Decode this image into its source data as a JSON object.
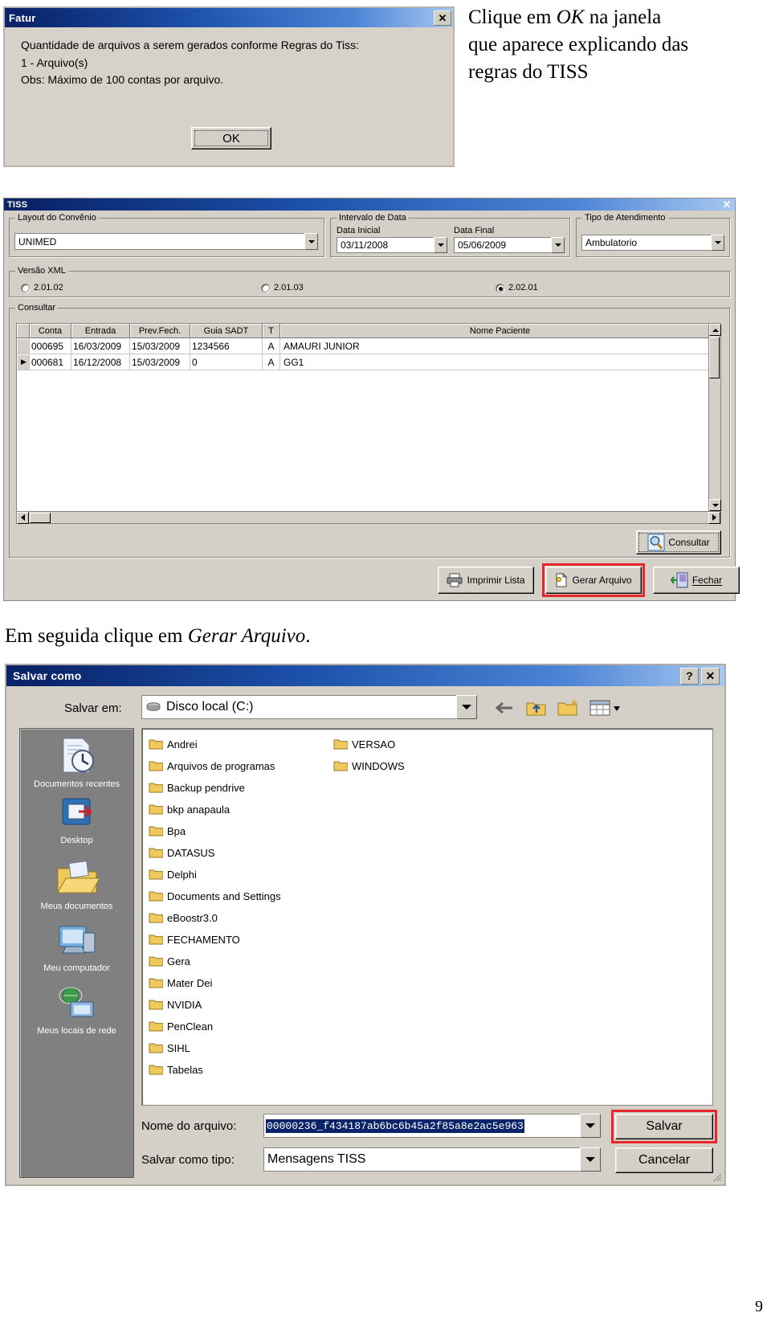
{
  "page": {
    "number": "9"
  },
  "narrative": {
    "step1_line1_a": "Clique em ",
    "step1_line1_em": "OK",
    "step1_line1_b": " na janela",
    "step1_line2": "que aparece explicando das",
    "step1_line3": "regras do TISS",
    "step2_a": "Em seguida clique em ",
    "step2_em": "Gerar Arquivo",
    "step2_b": "."
  },
  "fatur_dialog": {
    "title": "Fatur",
    "close_icon": "close-icon",
    "message_line1": "Quantidade de arquivos a serem gerados conforme Regras do Tiss:",
    "message_line2": "1 - Arquivo(s)",
    "message_line3": "Obs: Máximo de 100 contas por arquivo.",
    "ok_label": "OK"
  },
  "tiss_window": {
    "title": "TISS",
    "close_icon": "close-icon",
    "layout_group": {
      "legend": "Layout do Convênio",
      "value": "UNIMED"
    },
    "date_group": {
      "legend": "Intervalo de Data",
      "start_label": "Data Inicial",
      "start_value": "03/11/2008",
      "end_label": "Data Final",
      "end_value": "05/06/2009"
    },
    "attendance_group": {
      "legend": "Tipo de Atendimento",
      "value": "Ambulatorio"
    },
    "xml_group": {
      "legend": "Versão XML",
      "options": [
        {
          "label": "2.01.02",
          "selected": false
        },
        {
          "label": "2.01.03",
          "selected": false
        },
        {
          "label": "2.02.01",
          "selected": true
        }
      ]
    },
    "consult_group": {
      "legend": "Consultar",
      "columns": [
        "",
        "Conta",
        "Entrada",
        "Prev.Fech.",
        "Guia SADT",
        "T",
        "Nome Paciente"
      ],
      "rows": [
        {
          "indicator": "",
          "conta": "000695",
          "entrada": "16/03/2009",
          "prev": "15/03/2009",
          "guia": "1234566",
          "t": "A",
          "nome": "AMAURI JUNIOR"
        },
        {
          "indicator": "▶",
          "conta": "000681",
          "entrada": "16/12/2008",
          "prev": "15/03/2009",
          "guia": "0",
          "t": "A",
          "nome": "GG1"
        }
      ],
      "consultar_button": "Consultar",
      "consultar_icon": "magnifier-icon"
    },
    "footer_buttons": [
      {
        "label": "Imprimir Lista",
        "icon": "printer-icon",
        "highlighted": false
      },
      {
        "label": "Gerar Arquivo",
        "icon": "file-gear-icon",
        "highlighted": true
      },
      {
        "label": "Fechar",
        "icon": "exit-door-icon",
        "highlighted": false,
        "accel": "F"
      }
    ]
  },
  "save_dialog": {
    "title": "Salvar como",
    "help_icon": "help-question-icon",
    "close_icon": "close-icon",
    "save_in_label": "Salvar em:",
    "save_in_value": "Disco local (C:)",
    "save_in_icon": "harddisk-icon",
    "toolbar_icons": [
      "back-arrow-icon",
      "up-folder-icon",
      "new-folder-icon",
      "views-icon"
    ],
    "places": [
      {
        "label": "Documentos recentes",
        "icon": "recent-documents-icon"
      },
      {
        "label": "Desktop",
        "icon": "desktop-icon"
      },
      {
        "label": "Meus documentos",
        "icon": "my-documents-icon"
      },
      {
        "label": "Meu computador",
        "icon": "my-computer-icon"
      },
      {
        "label": "Meus locais de rede",
        "icon": "network-places-icon"
      }
    ],
    "folders_col1": [
      "Andrei",
      "Arquivos de programas",
      "Backup pendrive",
      "bkp anapaula",
      "Bpa",
      "DATASUS",
      "Delphi",
      "Documents and Settings",
      "eBoostr3.0",
      "FECHAMENTO",
      "Gera",
      "Mater Dei",
      "NVIDIA",
      "PenClean",
      "SIHL",
      "Tabelas"
    ],
    "folders_col2": [
      "VERSAO",
      "WINDOWS"
    ],
    "filename_label": "Nome do arquivo:",
    "filename_value": "00000236_f434187ab6bc6b45a2f85a8e2ac5e963",
    "filetype_label": "Salvar como tipo:",
    "filetype_value": "Mensagens TISS",
    "save_button": "Salvar",
    "cancel_button": "Cancelar"
  },
  "colors": {
    "titlebar_start": "#0a246a",
    "titlebar_end": "#a6c8f0",
    "dialog_face": "#d4d0c8",
    "highlight_red": "#e8252a",
    "selection_blue": "#0a246a",
    "places_bg": "#808080"
  }
}
